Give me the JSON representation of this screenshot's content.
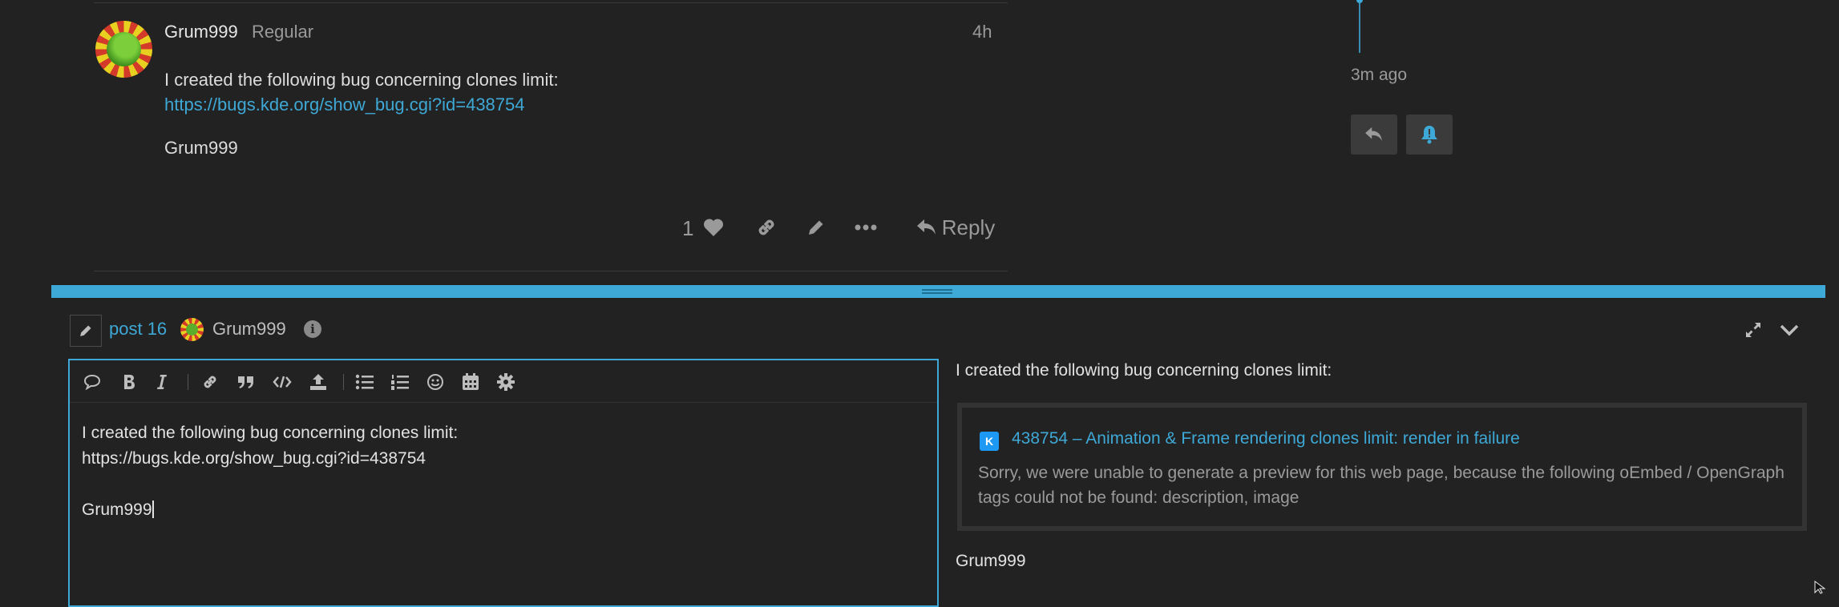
{
  "post": {
    "username": "Grum999",
    "user_title": "Regular",
    "date": "4h",
    "body_line1": "I created the following bug concerning clones limit:",
    "link": "https://bugs.kde.org/show_bug.cgi?id=438754",
    "signature": "Grum999",
    "like_count": "1",
    "reply_label": "Reply"
  },
  "timeline": {
    "ago": "3m ago"
  },
  "composer": {
    "post_number": "post 16",
    "reply_to_user": "Grum999",
    "info_glyph": "i",
    "editor_text": "I created the following bug concerning clones limit:\nhttps://bugs.kde.org/show_bug.cgi?id=438754\n\nGrum999",
    "preview": {
      "line1": "I created the following bug concerning clones limit:",
      "onebox_icon_text": "K",
      "onebox_title": "438754 – Animation & Frame rendering clones limit: render in failure",
      "onebox_description": "Sorry, we were unable to generate a preview for this web page, because the following oEmbed / OpenGraph tags could not be found: description, image",
      "signature": "Grum999"
    }
  },
  "colors": {
    "accent": "#3ea8d6",
    "background": "#222222",
    "text": "#dddddd",
    "muted": "#9a9a9a"
  }
}
